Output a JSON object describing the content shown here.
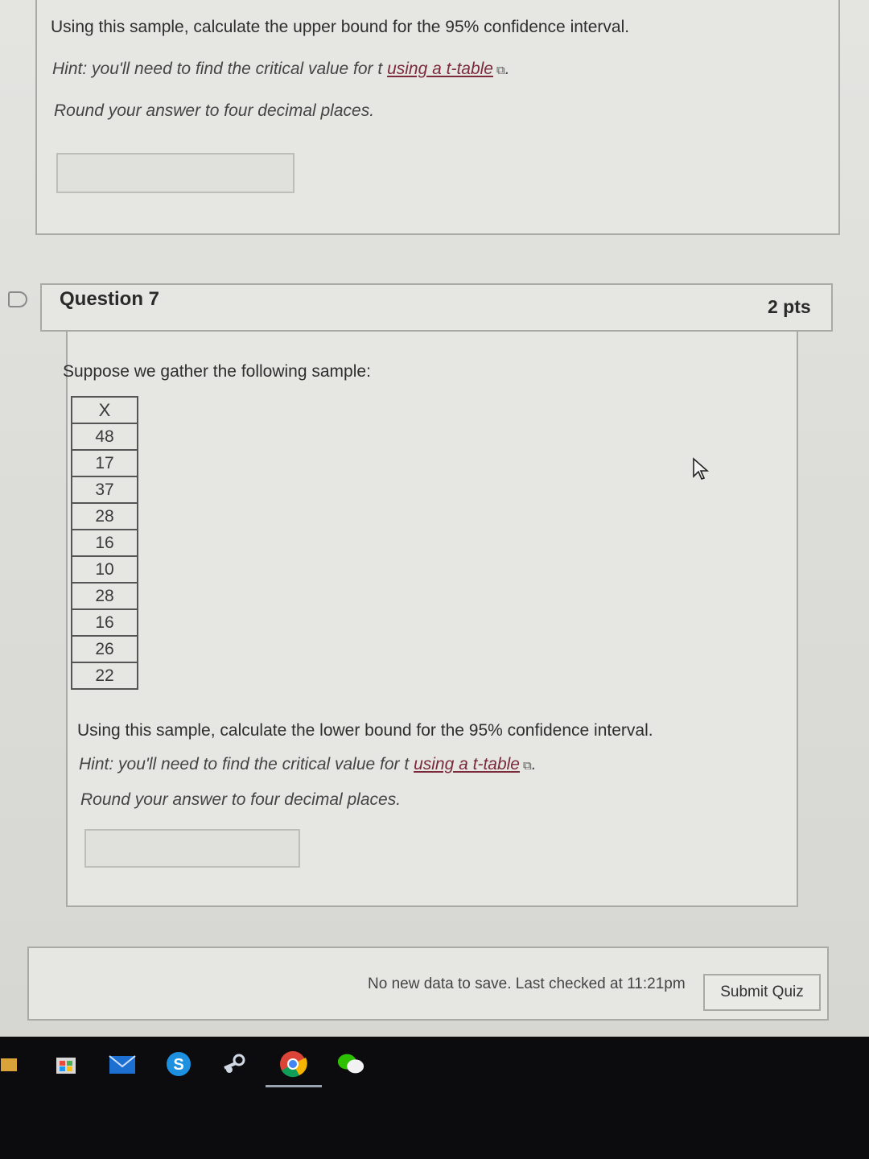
{
  "previous_question": {
    "prompt": "Using this sample, calculate the upper bound for the 95% confidence interval.",
    "hint_prefix": "Hint: you'll need to find the critical value for t",
    "hint_link": "using a t-table",
    "hint_suffix": ".",
    "rounding": "Round your answer to four decimal places.",
    "answer_value": ""
  },
  "question": {
    "title": "Question 7",
    "points": "2 pts",
    "intro": "Suppose we gather the following sample:",
    "table_header": "X",
    "values": [
      "48",
      "17",
      "37",
      "28",
      "16",
      "10",
      "28",
      "16",
      "26",
      "22"
    ],
    "prompt": "Using this sample, calculate the lower bound for the 95% confidence interval.",
    "hint_prefix": "Hint: you'll need to find the critical value for t",
    "hint_link": "using a t-table",
    "hint_suffix": ".",
    "rounding": "Round your answer to four decimal places.",
    "answer_value": ""
  },
  "footer": {
    "status": "No new data to save. Last checked at 11:21pm",
    "submit_label": "Submit Quiz"
  },
  "taskbar": {
    "icons": [
      "store-icon",
      "mail-icon",
      "skype-icon",
      "steam-icon",
      "chrome-icon",
      "wechat-icon"
    ]
  }
}
